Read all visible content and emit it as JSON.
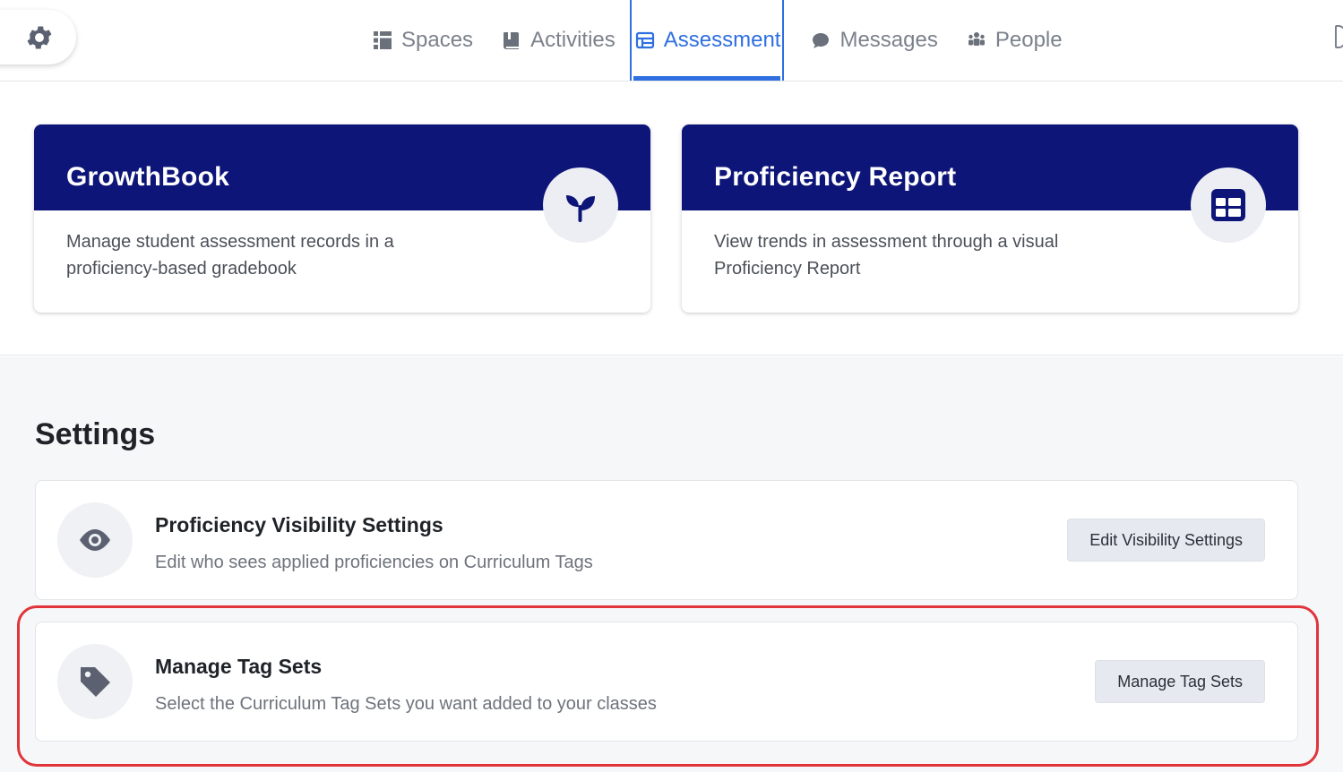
{
  "nav": {
    "items": [
      {
        "label": "Spaces",
        "icon": "spaces-icon"
      },
      {
        "label": "Activities",
        "icon": "book-icon"
      },
      {
        "label": "Assessment",
        "icon": "table-icon",
        "active": true
      },
      {
        "label": "Messages",
        "icon": "chat-bubble-icon"
      },
      {
        "label": "People",
        "icon": "people-icon"
      }
    ],
    "accent_color": "#2f6fe0"
  },
  "cards": {
    "growthbook": {
      "title": "GrowthBook",
      "description": "Manage student assessment records in a proficiency-based gradebook",
      "icon": "sprout-icon"
    },
    "proficiency_report": {
      "title": "Proficiency Report",
      "description": "View trends in assessment through a visual Proficiency Report",
      "icon": "table-grid-icon"
    },
    "header_color": "#0d1579"
  },
  "settings": {
    "title": "Settings",
    "visibility": {
      "title": "Proficiency Visibility Settings",
      "description": "Edit who sees applied proficiencies on Curriculum Tags",
      "button_label": "Edit Visibility Settings",
      "icon": "eye-icon"
    },
    "tag_sets": {
      "title": "Manage Tag Sets",
      "description": "Select the Curriculum Tag Sets you want added to your classes",
      "button_label": "Manage Tag Sets",
      "icon": "tag-icon"
    },
    "highlight_color": "#e0353b"
  }
}
